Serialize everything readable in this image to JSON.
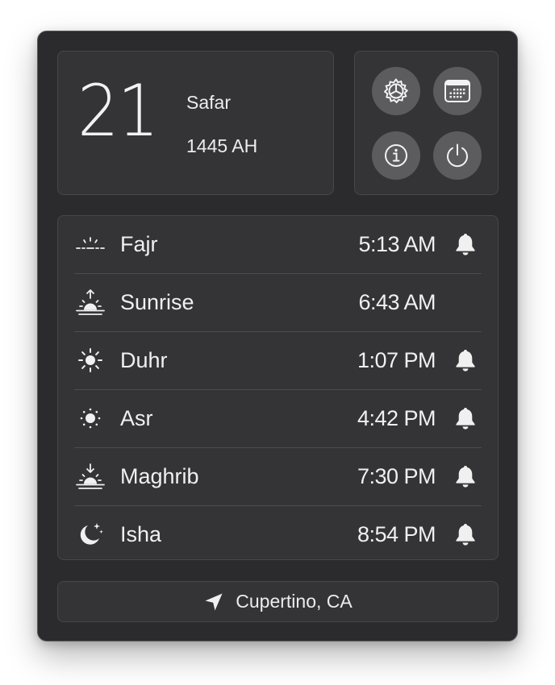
{
  "hijri_date": {
    "day": "21",
    "month": "Safar",
    "year": "1445 AH"
  },
  "actions": [
    {
      "name": "settings",
      "icon": "gear-icon"
    },
    {
      "name": "calendar",
      "icon": "calendar-icon"
    },
    {
      "name": "info",
      "icon": "info-icon"
    },
    {
      "name": "quit",
      "icon": "power-icon"
    }
  ],
  "prayers": [
    {
      "name": "Fajr",
      "time": "5:13 AM",
      "icon": "dawn-icon",
      "notification": true
    },
    {
      "name": "Sunrise",
      "time": "6:43 AM",
      "icon": "sunrise-icon",
      "notification": false
    },
    {
      "name": "Duhr",
      "time": "1:07 PM",
      "icon": "sun-icon",
      "notification": true
    },
    {
      "name": "Asr",
      "time": "4:42 PM",
      "icon": "sun-small-icon",
      "notification": true
    },
    {
      "name": "Maghrib",
      "time": "7:30 PM",
      "icon": "sunset-icon",
      "notification": true
    },
    {
      "name": "Isha",
      "time": "8:54 PM",
      "icon": "moon-stars-icon",
      "notification": true
    }
  ],
  "location": {
    "label": "Cupertino, CA",
    "icon": "location-arrow-icon"
  },
  "colors": {
    "panel_bg": "#2b2b2d",
    "card_bg": "#343436",
    "button_bg": "#5c5c5e",
    "text": "#f0f0f0"
  }
}
